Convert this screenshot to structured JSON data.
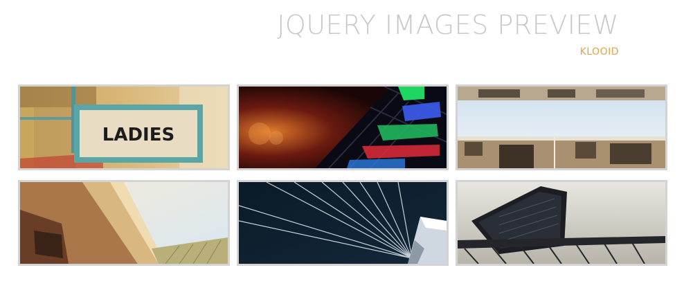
{
  "header": {
    "title": "JQUERY IMAGES PREVIEW",
    "subtitle": "KLOOID"
  },
  "gallery": {
    "images": [
      {
        "subject": "ladies-sign",
        "sign_text": "LADIES"
      },
      {
        "subject": "neon-building"
      },
      {
        "subject": "building-underside"
      },
      {
        "subject": "wooden-building"
      },
      {
        "subject": "bridge-cables"
      },
      {
        "subject": "dark-tower"
      }
    ]
  }
}
